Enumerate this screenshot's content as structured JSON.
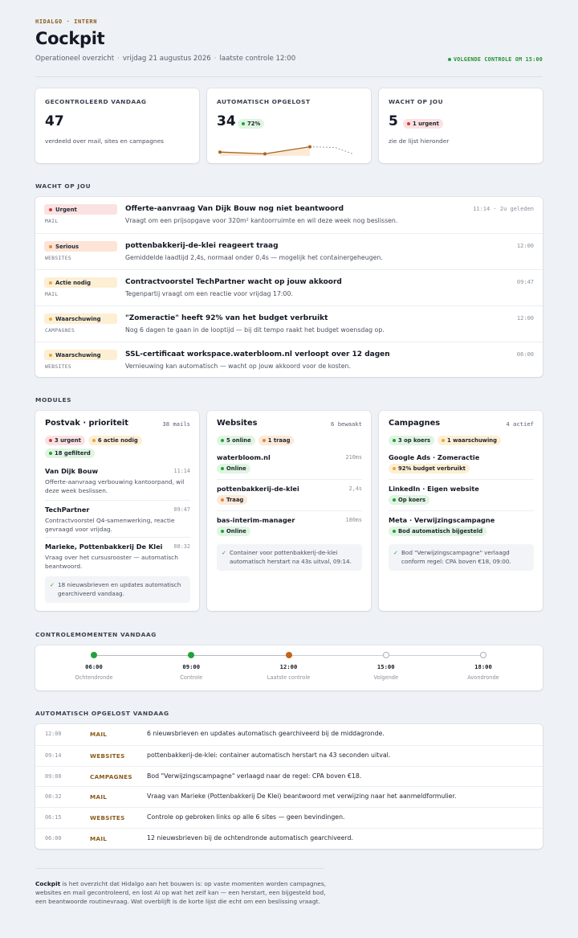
{
  "header": {
    "brand": "HIDALGO · INTERN",
    "title": "Cockpit",
    "subtitle_parts": [
      "Operationeel overzicht",
      "vrijdag 21 augustus 2026",
      "laatste controle 12:00"
    ],
    "next_check": "VOLGENDE CONTROLE OM 15:00"
  },
  "colors": {
    "accent_brown": "#8a5a1a",
    "green": "#22a13a",
    "red": "#d33a3a",
    "orange": "#e3873a",
    "amber": "#e8a73a"
  },
  "stats": {
    "checked": {
      "label": "GECONTROLEERD VANDAAG",
      "value": "47",
      "desc": "verdeeld over mail, sites en campagnes"
    },
    "auto": {
      "label": "AUTOMATISCH OPGELOST",
      "value": "34",
      "pill": "72%",
      "trend": [
        34,
        33,
        37
      ]
    },
    "waiting": {
      "label": "WACHT OP JOU",
      "value": "5",
      "pill": "1 urgent",
      "desc": "zie de lijst hieronder"
    }
  },
  "attention": {
    "label": "WACHT OP JOU",
    "items": [
      {
        "tag": "Urgent",
        "level": "red",
        "channel": "MAIL",
        "title": "Offerte-aanvraag Van Dijk Bouw nog niet beantwoord",
        "body": "Vraagt om een prijsopgave voor 320m² kantoorruimte en wil deze week nog beslissen.",
        "time": "11:14 · 2u geleden"
      },
      {
        "tag": "Serious",
        "level": "orange",
        "channel": "WEBSITES",
        "title": "pottenbakkerij-de-klei reageert traag",
        "body": "Gemiddelde laadtijd 2,4s, normaal onder 0,4s — mogelijk het containergeheugen.",
        "time": "12:00"
      },
      {
        "tag": "Actie nodig",
        "level": "amber",
        "channel": "MAIL",
        "title": "Contractvoorstel TechPartner wacht op jouw akkoord",
        "body": "Tegenpartij vraagt om een reactie voor vrijdag 17:00.",
        "time": "09:47"
      },
      {
        "tag": "Waarschuwing",
        "level": "amber",
        "channel": "CAMPAGNES",
        "title": "\"Zomeractie\" heeft 92% van het budget verbruikt",
        "body": "Nog 6 dagen te gaan in de looptijd — bij dit tempo raakt het budget woensdag op.",
        "time": "12:00"
      },
      {
        "tag": "Waarschuwing",
        "level": "amber",
        "channel": "WEBSITES",
        "title": "SSL-certificaat workspace.waterbloom.nl verloopt over 12 dagen",
        "body": "Vernieuwing kan automatisch — wacht op jouw akkoord voor de kosten.",
        "time": "06:00"
      }
    ]
  },
  "modules": {
    "label": "MODULES",
    "mail": {
      "title": "Postvak · prioriteit",
      "count": "38 mails",
      "pills": [
        {
          "text": "3 urgent",
          "level": "red"
        },
        {
          "text": "6 actie nodig",
          "level": "amber"
        },
        {
          "text": "18 gefilterd",
          "level": "green"
        }
      ],
      "items": [
        {
          "from": "Van Dijk Bouw",
          "time": "11:14",
          "snippet": "Offerte-aanvraag verbouwing kantoorpand, wil deze week beslissen."
        },
        {
          "from": "TechPartner",
          "time": "09:47",
          "snippet": "Contractvoorstel Q4-samenwerking, reactie gevraagd voor vrijdag."
        },
        {
          "from": "Marieke, Pottenbakkerij De Klei",
          "time": "08:32",
          "snippet": "Vraag over het cursusrooster — automatisch beantwoord."
        }
      ],
      "note": "18 nieuwsbrieven en updates automatisch gearchiveerd vandaag."
    },
    "websites": {
      "title": "Websites",
      "count": "6 bewaakt",
      "pills": [
        {
          "text": "5 online",
          "level": "green"
        },
        {
          "text": "1 traag",
          "level": "orange"
        }
      ],
      "items": [
        {
          "name": "waterbloom.nl",
          "meta": "210ms",
          "status": "Online",
          "level": "green"
        },
        {
          "name": "pottenbakkerij-de-klei",
          "meta": "2,4s",
          "status": "Traag",
          "level": "orange"
        },
        {
          "name": "bas-interim-manager",
          "meta": "180ms",
          "status": "Online",
          "level": "green"
        }
      ],
      "note": "Container voor pottenbakkerij-de-klei automatisch herstart na 43s uitval, 09:14."
    },
    "campaigns": {
      "title": "Campagnes",
      "count": "4 actief",
      "pills": [
        {
          "text": "3 op koers",
          "level": "green"
        },
        {
          "text": "1 waarschuwing",
          "level": "amber"
        }
      ],
      "items": [
        {
          "name": "Google Ads · Zomeractie",
          "status": "92% budget verbruikt",
          "level": "amber"
        },
        {
          "name": "LinkedIn · Eigen website",
          "status": "Op koers",
          "level": "green"
        },
        {
          "name": "Meta · Verwijzingscampagne",
          "status": "Bod automatisch bijgesteld",
          "level": "green"
        }
      ],
      "note": "Bod \"Verwijzingscampagne\" verlaagd conform regel: CPA boven €18, 09:00."
    }
  },
  "timeline": {
    "label": "CONTROLEMOMENTEN VANDAAG",
    "points": [
      {
        "time": "06:00",
        "label": "Ochtendronde",
        "state": "done"
      },
      {
        "time": "09:00",
        "label": "Controle",
        "state": "done"
      },
      {
        "time": "12:00",
        "label": "Laatste controle",
        "state": "current"
      },
      {
        "time": "15:00",
        "label": "Volgende",
        "state": "future"
      },
      {
        "time": "18:00",
        "label": "Avondronde",
        "state": "future"
      }
    ]
  },
  "auto_log": {
    "label": "AUTOMATISCH OPGELOST VANDAAG",
    "rows": [
      {
        "time": "12:00",
        "channel": "MAIL",
        "text": "6 nieuwsbrieven en updates automatisch gearchiveerd bij de middagronde."
      },
      {
        "time": "09:14",
        "channel": "WEBSITES",
        "text": "pottenbakkerij-de-klei: container automatisch herstart na 43 seconden uitval."
      },
      {
        "time": "09:00",
        "channel": "CAMPAGNES",
        "text": "Bod \"Verwijzingscampagne\" verlaagd naar de regel: CPA boven €18."
      },
      {
        "time": "08:32",
        "channel": "MAIL",
        "text": "Vraag van Marieke (Pottenbakkerij De Klei) beantwoord met verwijzing naar het aanmeldformulier."
      },
      {
        "time": "06:15",
        "channel": "WEBSITES",
        "text": "Controle op gebroken links op alle 6 sites — geen bevindingen."
      },
      {
        "time": "06:00",
        "channel": "MAIL",
        "text": "12 nieuwsbrieven bij de ochtendronde automatisch gearchiveerd."
      }
    ]
  },
  "footer": {
    "bold": "Cockpit",
    "text": " is het overzicht dat Hidalgo aan het bouwen is: op vaste momenten worden campagnes, websites en mail gecontroleerd, en lost AI op wat het zelf kan — een herstart, een bijgesteld bod, een beantwoorde routinevraag. Wat overblijft is de korte lijst die echt om een beslissing vraagt."
  }
}
